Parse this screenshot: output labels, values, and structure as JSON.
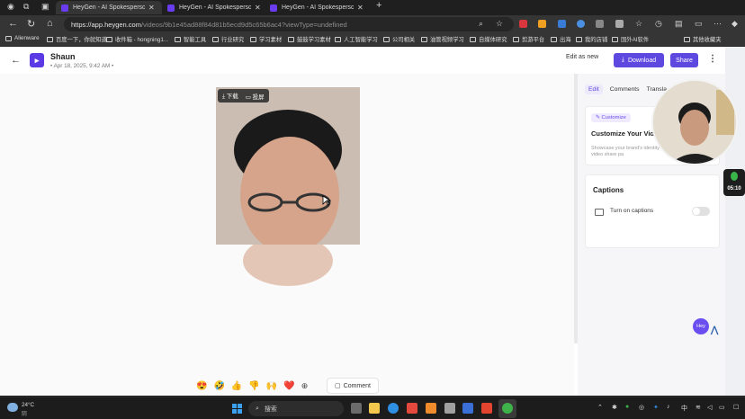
{
  "browser": {
    "tabs": [
      {
        "title": "HeyGen - AI Spokesperson Vide",
        "active": true
      },
      {
        "title": "HeyGen - AI Spokesperson Vide",
        "active": false
      },
      {
        "title": "HeyGen - AI Spokesperson Vide",
        "active": false
      }
    ],
    "url_host": "https://app.heygen.com",
    "url_path": "/videos/9b1e45ad88f84d81b5ecd9d5c65b6ac4?viewType=undefined",
    "bookmarks": [
      "Alienware",
      "百度一下，你就知道",
      "收件箱 - hongning1...",
      "智能工具",
      "行业研究",
      "学习素材",
      "鼓鼓学习素材",
      "人工智能学习",
      "公司相关",
      "油管视频学习",
      "自媒体研究",
      "剪游平台",
      "出海",
      "我的店铺",
      "国外AI软件",
      "其他收藏夹"
    ]
  },
  "header": {
    "title": "Shaun",
    "meta": "• Apr 18, 2025, 9:42 AM •",
    "edit_label": "Edit as new",
    "download_label": "Download",
    "share_label": "Share"
  },
  "video": {
    "toolbar_download": "下载",
    "toolbar_cast": "投屏"
  },
  "reactions": [
    "😍",
    "🤣",
    "👍",
    "👎",
    "🙌",
    "❤️"
  ],
  "comment_label": "Comment",
  "panel": {
    "tabs": [
      "Edit",
      "Comments",
      "Transla"
    ],
    "customize_pill": "Customize",
    "customize_title": "Customize Your Video",
    "customize_desc": "Showcase your brand's identity by every detail of your video share pa",
    "captions_title": "Captions",
    "captions_toggle_label": "Turn on captions"
  },
  "chat_bubble": "Hey",
  "recorder_time": "05:10",
  "taskbar": {
    "temp": "24°C",
    "weather": "阴",
    "search": "搜索"
  },
  "colors": {
    "accent": "#5d48e0",
    "brand": "#5b3ae6"
  }
}
